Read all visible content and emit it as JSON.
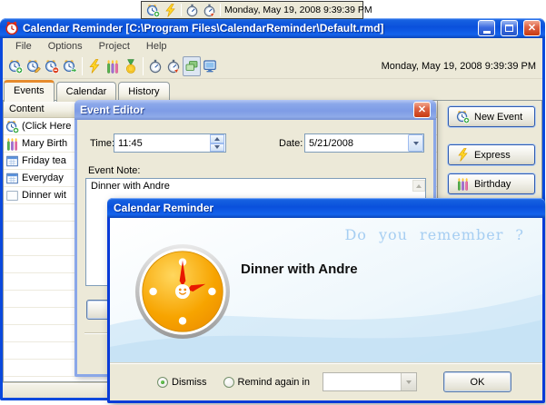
{
  "colors": {
    "titlebar_active": "#0f59dd",
    "titlebar_inactive": "#8aa7e8",
    "window_chrome_blue": "#0a49dd",
    "ui_face": "#ece9d8",
    "active_tab_stripe": "#e68b2c",
    "clock_orange": "#f7a400",
    "watermark_blue": "#a6cef2"
  },
  "floating_toolbar": {
    "datetime": "Monday, May 19, 2008 9:39:39 PM"
  },
  "main_window": {
    "title": "Calendar Reminder [C:\\Program Files\\CalendarReminder\\Default.rmd]",
    "menu": [
      "File",
      "Options",
      "Project",
      "Help"
    ],
    "toolbar_datetime": "Monday, May 19, 2008 9:39:39 PM",
    "tabs": [
      "Events",
      "Calendar",
      "History"
    ],
    "list_header": "Content",
    "list_items": [
      {
        "icon": "alarm-add-icon",
        "label": "(Click Here"
      },
      {
        "icon": "birthday-candles-icon",
        "label": "Mary Birth"
      },
      {
        "icon": "calendar-icon",
        "label": "Friday tea"
      },
      {
        "icon": "calendar-icon",
        "label": "Everyday"
      },
      {
        "icon": "blank-note-icon",
        "label": "Dinner wit"
      }
    ],
    "side_buttons": [
      {
        "label": "New Event"
      },
      {
        "label": "Express"
      },
      {
        "label": "Birthday"
      }
    ]
  },
  "event_editor": {
    "title": "Event Editor",
    "time_label": "Time:",
    "time_value": "11:45",
    "date_label": "Date:",
    "date_value": "5/21/2008",
    "note_label": "Event Note:",
    "note_value": "Dinner with Andre"
  },
  "reminder_popup": {
    "title": "Calendar Reminder",
    "watermark": "Do you remember ?",
    "message": "Dinner with Andre",
    "options": {
      "dismiss": "Dismiss",
      "remind": "Remind again in"
    },
    "ok_label": "OK"
  }
}
